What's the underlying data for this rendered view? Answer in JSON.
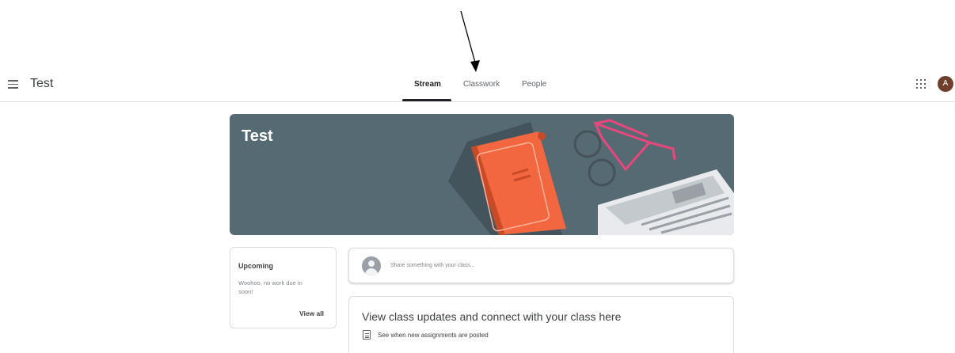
{
  "class": {
    "name": "Test"
  },
  "tabs": [
    {
      "label": "Stream",
      "active": true
    },
    {
      "label": "Classwork",
      "active": false
    },
    {
      "label": "People",
      "active": false
    }
  ],
  "user": {
    "avatar_letter": "A"
  },
  "banner": {
    "title": "Test"
  },
  "upcoming": {
    "title": "Upcoming",
    "text": "Woohoo, no work due in soon!",
    "view_all": "View all"
  },
  "share": {
    "placeholder": "Share something with your class..."
  },
  "info": {
    "title": "View class updates and connect with your class here",
    "line": "See when new assignments are posted"
  },
  "icons": {
    "menu": "hamburger-menu-icon",
    "apps": "apps-grid-icon",
    "info": "assignment-icon"
  },
  "colors": {
    "banner_bg": "#566a74",
    "book": "#f2673f",
    "glasses": "#e8467c",
    "avatar_bg": "#6d3f2c"
  }
}
